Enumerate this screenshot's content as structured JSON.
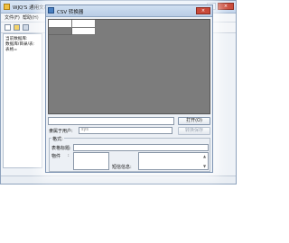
{
  "main_window": {
    "title": "WJQ'S 通用文本型数据库",
    "close_glyph": "×",
    "menu": [
      "文件(F)",
      "帮助(H)"
    ],
    "left_pane_lines": [
      "当前数据库: ",
      "数据库/目录/表: ",
      "表格="
    ]
  },
  "dialog": {
    "title": "CSV 转换器",
    "close_glyph": "×",
    "grid_header_cells": 2,
    "open_button": "打开(O)",
    "save_button": "转换保存",
    "owner_label": "隶属于用户:",
    "owner_value": "sys",
    "format_label": "格式:",
    "table_title_label": "表格标题:",
    "field_label": "物件",
    "field_colon": ":",
    "short_info_label": "短信信息:",
    "scroll_up_glyph": "▲",
    "scroll_down_glyph": "▼"
  }
}
